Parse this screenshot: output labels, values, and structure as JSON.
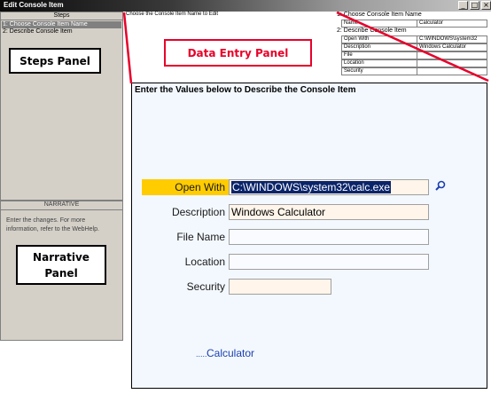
{
  "window": {
    "title": "Edit Console Item"
  },
  "steps": {
    "header": "Steps",
    "items": [
      "1: Choose Console Item Name",
      "2: Describe Console Item"
    ]
  },
  "callouts": {
    "steps": "Steps Panel",
    "narrative_line1": "Narrative",
    "narrative_line2": "Panel",
    "data_entry": "Data Entry Panel"
  },
  "narrative": {
    "header": "NARRATIVE",
    "text": "Enter the changes. For more information, refer to the WebHelp."
  },
  "data_entry": {
    "choose_label": "Choose the Console Item Name to Edit"
  },
  "summary": {
    "step1_title": "1: Choose Console Item Name",
    "name_key": "Name",
    "name_value": "Calculator",
    "step2_title": "2: Describe Console Item",
    "rows": [
      {
        "key": "Open With",
        "value": "C:\\WINDOWS\\system32"
      },
      {
        "key": "Description",
        "value": "Windows Calculator"
      },
      {
        "key": "File",
        "value": ""
      },
      {
        "key": "Location",
        "value": ""
      },
      {
        "key": "Security",
        "value": ""
      }
    ]
  },
  "main": {
    "heading": "Enter the Values below to Describe the Console Item",
    "fields": {
      "open_with": {
        "label": "Open With",
        "value": "C:\\WINDOWS\\system32\\calc.exe"
      },
      "description": {
        "label": "Description",
        "value": "Windows Calculator"
      },
      "file_name": {
        "label": "File Name",
        "value": ""
      },
      "location": {
        "label": "Location",
        "value": ""
      },
      "security": {
        "label": "Security",
        "value": ""
      }
    },
    "tree_dots": ".....",
    "tree_item": "Calculator"
  },
  "colors": {
    "accent_red": "#e8002a",
    "highlight_yellow": "#ffcc00",
    "selection_blue": "#0a246a",
    "input_tint": "#fff5ea"
  },
  "icons": {
    "browse": "magnifier-icon"
  }
}
